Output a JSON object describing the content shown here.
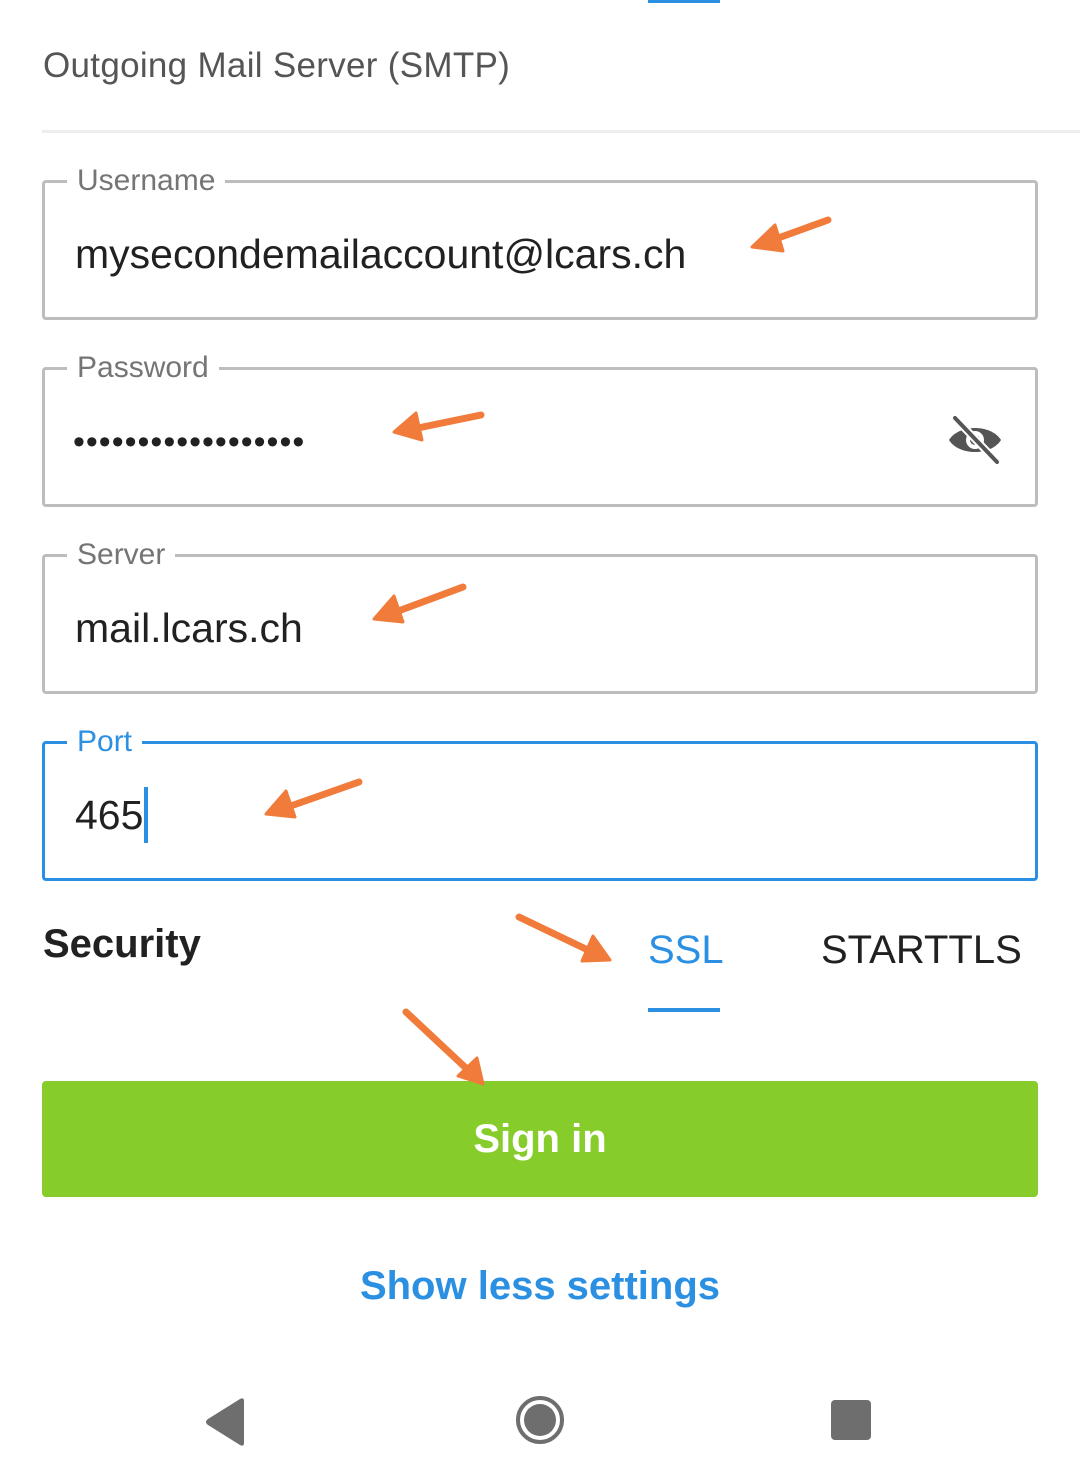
{
  "section": {
    "title": "Outgoing Mail Server (SMTP)"
  },
  "fields": {
    "username": {
      "label": "Username",
      "value": "mysecondemailaccount@lcars.ch"
    },
    "password": {
      "label": "Password",
      "masked_value": "••••••••••••••••••",
      "toggle_icon": "eye-off-icon"
    },
    "server": {
      "label": "Server",
      "value": "mail.lcars.ch"
    },
    "port": {
      "label": "Port",
      "value": "465",
      "focused": true
    }
  },
  "security": {
    "label": "Security",
    "options": [
      "SSL",
      "STARTTLS"
    ],
    "selected": "SSL"
  },
  "actions": {
    "sign_in": "Sign in",
    "show_less": "Show less settings"
  },
  "navbar": {
    "icons": [
      "back-icon",
      "home-icon",
      "recents-icon"
    ]
  },
  "colors": {
    "accent": "#2b8fe2",
    "primary_button": "#86cc2a",
    "annotation_arrow": "#f07b3a",
    "field_border": "#bdbdbd"
  }
}
